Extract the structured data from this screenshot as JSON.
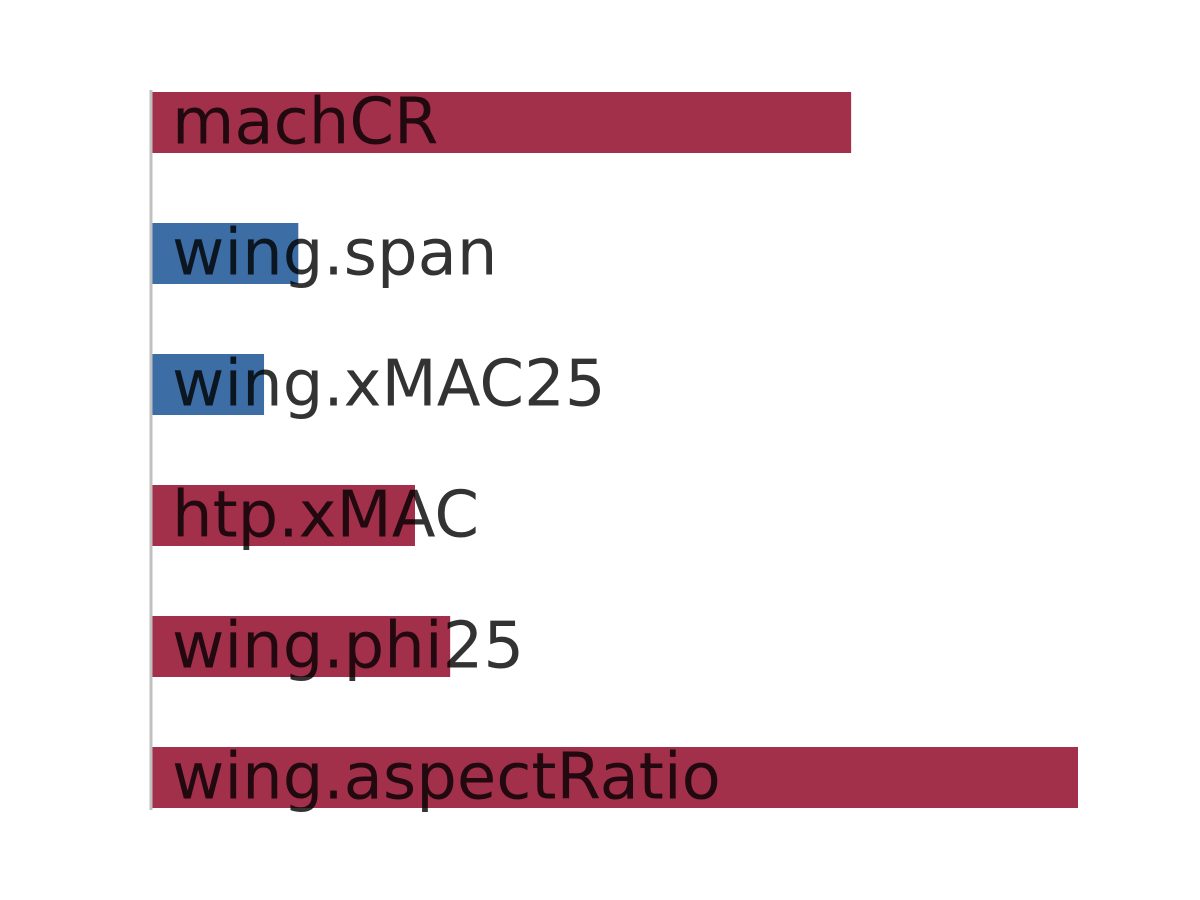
{
  "chart_data": {
    "type": "bar",
    "orientation": "horizontal",
    "title": "",
    "xlabel": "",
    "ylabel": "",
    "categories": [
      "machCR",
      "wing.span",
      "wing.xMAC25",
      "htp.xMAC",
      "wing.phi25",
      "wing.aspectRatio"
    ],
    "values": [
      0.755,
      -0.158,
      -0.121,
      0.284,
      0.322,
      1.0
    ],
    "xlim": [
      0,
      1
    ],
    "grid": false,
    "legend": "none",
    "colors": {
      "negative": "#3d6da5",
      "positive": "#a3304b",
      "axis": "#c0c0c0"
    }
  }
}
